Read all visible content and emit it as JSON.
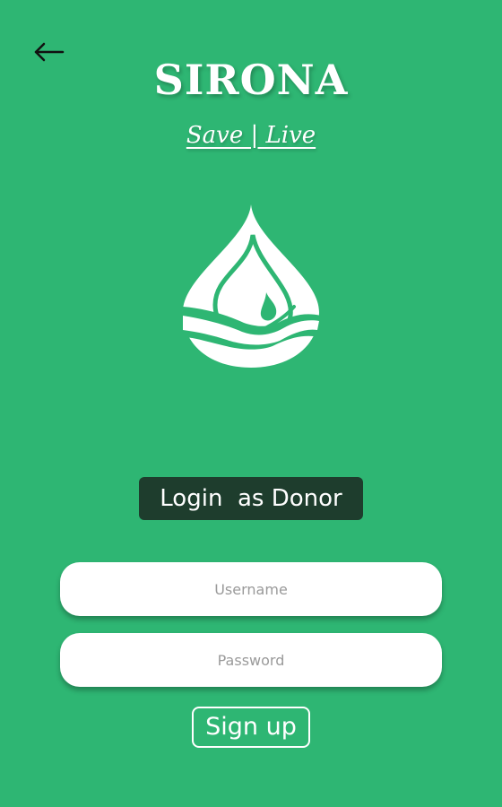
{
  "app": {
    "title": "SIRONA",
    "tagline": "Save | Live"
  },
  "nav": {
    "back_icon": "arrow-left-icon"
  },
  "logo": {
    "icon": "water-drop-hand-icon"
  },
  "login": {
    "role_label": "Login  as Donor",
    "username_placeholder": "Username",
    "password_placeholder": "Password",
    "signup_label": "Sign up"
  },
  "colors": {
    "background": "#2eb673",
    "role_badge": "#1e3d2d",
    "field_bg": "#ffffff"
  }
}
